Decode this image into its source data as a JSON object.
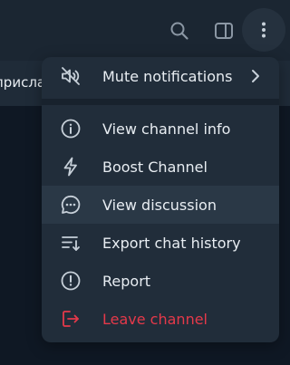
{
  "pinned": {
    "text": "присла"
  },
  "menu": {
    "items": [
      {
        "label": "Mute notifications",
        "icon": "mute-icon"
      },
      {
        "label": "View channel info",
        "icon": "info-icon"
      },
      {
        "label": "Boost Channel",
        "icon": "boost-icon"
      },
      {
        "label": "View discussion",
        "icon": "discussion-icon"
      },
      {
        "label": "Export chat history",
        "icon": "export-icon"
      },
      {
        "label": "Report",
        "icon": "report-icon"
      },
      {
        "label": "Leave channel",
        "icon": "leave-icon"
      }
    ]
  },
  "colors": {
    "danger": "#e5394a",
    "menu_bg": "#212d3a",
    "hover_bg": "#2a3846"
  }
}
